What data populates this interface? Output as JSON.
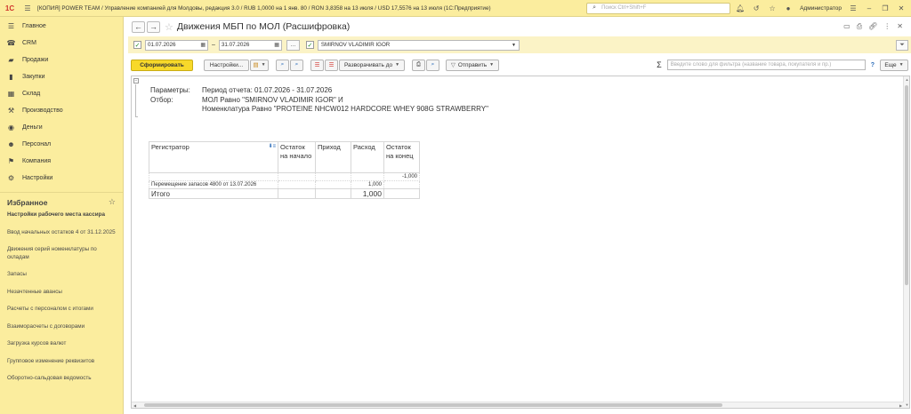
{
  "app": {
    "logo": "1С",
    "title": "[КОПИЯ] POWER TEAM / Управление компанией для Молдовы, редакция 3.0 / RUB 1,0000 на 1 янв. 80 / RON 3,8358 на 13 июля / USD 17,5576 на 13 июля (1С:Предприятие)",
    "search_placeholder": "Поиск Ctrl+Shift+F",
    "user": "Администратор"
  },
  "sidebar": {
    "sections": [
      {
        "label": "Главное",
        "icon": "home-icon"
      },
      {
        "label": "CRM",
        "icon": "crm-icon"
      },
      {
        "label": "Продажи",
        "icon": "sales-icon"
      },
      {
        "label": "Закупки",
        "icon": "purchases-icon"
      },
      {
        "label": "Склад",
        "icon": "warehouse-icon"
      },
      {
        "label": "Производство",
        "icon": "production-icon"
      },
      {
        "label": "Деньги",
        "icon": "money-icon"
      },
      {
        "label": "Персонал",
        "icon": "personnel-icon"
      },
      {
        "label": "Компания",
        "icon": "company-icon"
      },
      {
        "label": "Настройки",
        "icon": "settings-icon"
      }
    ],
    "favorites_title": "Избранное",
    "favorites": [
      "Настройки рабочего места кассира",
      "Ввод начальных остатков 4 от 31.12.2025",
      "Движения серий номенклатуры по складам",
      "Запасы",
      "Незачтенные авансы",
      "Расчеты с персоналом с итогами",
      "Взаиморасчеты с договорами",
      "Загрузка курсов валют",
      "Групповое изменение реквизитов",
      "Оборотно-сальдовая ведомость"
    ]
  },
  "report_header": {
    "title": "Движения МБП по МОЛ (Расшифровка)"
  },
  "filters": {
    "date_from": "01.07.2026",
    "date_to": "31.07.2026",
    "dash": "–",
    "ellipsis": "...",
    "mol": "SMIRNOV VLADIMIR IGOR"
  },
  "commands": {
    "generate": "Сформировать",
    "settings": "Настройки...",
    "expand_to": "Разворачивать до",
    "send": "Отправить",
    "sigma": "Σ",
    "filter_placeholder": "Введите слово для фильтра (название товара, покупателя и пр.)",
    "help": "?",
    "more": "Еще"
  },
  "report": {
    "params_label": "Параметры:",
    "params_value": "Период отчета: 01.07.2026 - 31.07.2026",
    "filter_label": "Отбор:",
    "filter_line1": "МОЛ Равно \"SMIRNOV VLADIMIR IGOR\" И",
    "filter_line2": "Номенклатура Равно \"PROTEINE NHCW012 HARDCORE WHEY 908G STRAWBERRY\"",
    "columns": {
      "registrar": "Регистратор",
      "opening": "Остаток на начало",
      "income": "Приход",
      "expense": "Расход",
      "closing": "Остаток на конец"
    },
    "rows": [
      {
        "registrar": "",
        "opening": "",
        "income": "",
        "expense": "",
        "closing": "-1,000"
      },
      {
        "registrar": "Перемещение запасов 4800 от 13.07.2026",
        "opening": "",
        "income": "",
        "expense": "1,000",
        "closing": ""
      }
    ],
    "total": {
      "registrar": "Итого",
      "opening": "",
      "income": "",
      "expense": "1,000",
      "closing": ""
    }
  }
}
